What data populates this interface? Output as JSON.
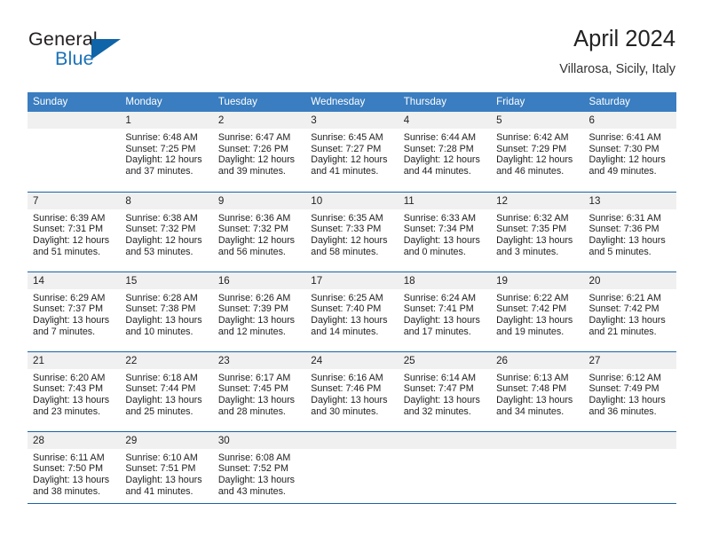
{
  "brand": {
    "name_top": "General",
    "name_bottom": "Blue",
    "flag_icon": "blue-triangle-flag-icon",
    "color_top": "#231f20",
    "color_bottom": "#1b72b8"
  },
  "header": {
    "title": "April 2024",
    "subtitle": "Villarosa, Sicily, Italy"
  },
  "theme": {
    "header_row_bg": "#3a7dc0",
    "header_row_text": "#ffffff",
    "row_divider": "#1a63a8",
    "day_band_bg": "#f0f0f0",
    "body_text": "#222222"
  },
  "weekdays": [
    "Sunday",
    "Monday",
    "Tuesday",
    "Wednesday",
    "Thursday",
    "Friday",
    "Saturday"
  ],
  "weeks": [
    [
      {
        "day": "",
        "lines": []
      },
      {
        "day": "1",
        "lines": [
          "Sunrise: 6:48 AM",
          "Sunset: 7:25 PM",
          "Daylight: 12 hours",
          "and 37 minutes."
        ]
      },
      {
        "day": "2",
        "lines": [
          "Sunrise: 6:47 AM",
          "Sunset: 7:26 PM",
          "Daylight: 12 hours",
          "and 39 minutes."
        ]
      },
      {
        "day": "3",
        "lines": [
          "Sunrise: 6:45 AM",
          "Sunset: 7:27 PM",
          "Daylight: 12 hours",
          "and 41 minutes."
        ]
      },
      {
        "day": "4",
        "lines": [
          "Sunrise: 6:44 AM",
          "Sunset: 7:28 PM",
          "Daylight: 12 hours",
          "and 44 minutes."
        ]
      },
      {
        "day": "5",
        "lines": [
          "Sunrise: 6:42 AM",
          "Sunset: 7:29 PM",
          "Daylight: 12 hours",
          "and 46 minutes."
        ]
      },
      {
        "day": "6",
        "lines": [
          "Sunrise: 6:41 AM",
          "Sunset: 7:30 PM",
          "Daylight: 12 hours",
          "and 49 minutes."
        ]
      }
    ],
    [
      {
        "day": "7",
        "lines": [
          "Sunrise: 6:39 AM",
          "Sunset: 7:31 PM",
          "Daylight: 12 hours",
          "and 51 minutes."
        ]
      },
      {
        "day": "8",
        "lines": [
          "Sunrise: 6:38 AM",
          "Sunset: 7:32 PM",
          "Daylight: 12 hours",
          "and 53 minutes."
        ]
      },
      {
        "day": "9",
        "lines": [
          "Sunrise: 6:36 AM",
          "Sunset: 7:32 PM",
          "Daylight: 12 hours",
          "and 56 minutes."
        ]
      },
      {
        "day": "10",
        "lines": [
          "Sunrise: 6:35 AM",
          "Sunset: 7:33 PM",
          "Daylight: 12 hours",
          "and 58 minutes."
        ]
      },
      {
        "day": "11",
        "lines": [
          "Sunrise: 6:33 AM",
          "Sunset: 7:34 PM",
          "Daylight: 13 hours",
          "and 0 minutes."
        ]
      },
      {
        "day": "12",
        "lines": [
          "Sunrise: 6:32 AM",
          "Sunset: 7:35 PM",
          "Daylight: 13 hours",
          "and 3 minutes."
        ]
      },
      {
        "day": "13",
        "lines": [
          "Sunrise: 6:31 AM",
          "Sunset: 7:36 PM",
          "Daylight: 13 hours",
          "and 5 minutes."
        ]
      }
    ],
    [
      {
        "day": "14",
        "lines": [
          "Sunrise: 6:29 AM",
          "Sunset: 7:37 PM",
          "Daylight: 13 hours",
          "and 7 minutes."
        ]
      },
      {
        "day": "15",
        "lines": [
          "Sunrise: 6:28 AM",
          "Sunset: 7:38 PM",
          "Daylight: 13 hours",
          "and 10 minutes."
        ]
      },
      {
        "day": "16",
        "lines": [
          "Sunrise: 6:26 AM",
          "Sunset: 7:39 PM",
          "Daylight: 13 hours",
          "and 12 minutes."
        ]
      },
      {
        "day": "17",
        "lines": [
          "Sunrise: 6:25 AM",
          "Sunset: 7:40 PM",
          "Daylight: 13 hours",
          "and 14 minutes."
        ]
      },
      {
        "day": "18",
        "lines": [
          "Sunrise: 6:24 AM",
          "Sunset: 7:41 PM",
          "Daylight: 13 hours",
          "and 17 minutes."
        ]
      },
      {
        "day": "19",
        "lines": [
          "Sunrise: 6:22 AM",
          "Sunset: 7:42 PM",
          "Daylight: 13 hours",
          "and 19 minutes."
        ]
      },
      {
        "day": "20",
        "lines": [
          "Sunrise: 6:21 AM",
          "Sunset: 7:42 PM",
          "Daylight: 13 hours",
          "and 21 minutes."
        ]
      }
    ],
    [
      {
        "day": "21",
        "lines": [
          "Sunrise: 6:20 AM",
          "Sunset: 7:43 PM",
          "Daylight: 13 hours",
          "and 23 minutes."
        ]
      },
      {
        "day": "22",
        "lines": [
          "Sunrise: 6:18 AM",
          "Sunset: 7:44 PM",
          "Daylight: 13 hours",
          "and 25 minutes."
        ]
      },
      {
        "day": "23",
        "lines": [
          "Sunrise: 6:17 AM",
          "Sunset: 7:45 PM",
          "Daylight: 13 hours",
          "and 28 minutes."
        ]
      },
      {
        "day": "24",
        "lines": [
          "Sunrise: 6:16 AM",
          "Sunset: 7:46 PM",
          "Daylight: 13 hours",
          "and 30 minutes."
        ]
      },
      {
        "day": "25",
        "lines": [
          "Sunrise: 6:14 AM",
          "Sunset: 7:47 PM",
          "Daylight: 13 hours",
          "and 32 minutes."
        ]
      },
      {
        "day": "26",
        "lines": [
          "Sunrise: 6:13 AM",
          "Sunset: 7:48 PM",
          "Daylight: 13 hours",
          "and 34 minutes."
        ]
      },
      {
        "day": "27",
        "lines": [
          "Sunrise: 6:12 AM",
          "Sunset: 7:49 PM",
          "Daylight: 13 hours",
          "and 36 minutes."
        ]
      }
    ],
    [
      {
        "day": "28",
        "lines": [
          "Sunrise: 6:11 AM",
          "Sunset: 7:50 PM",
          "Daylight: 13 hours",
          "and 38 minutes."
        ]
      },
      {
        "day": "29",
        "lines": [
          "Sunrise: 6:10 AM",
          "Sunset: 7:51 PM",
          "Daylight: 13 hours",
          "and 41 minutes."
        ]
      },
      {
        "day": "30",
        "lines": [
          "Sunrise: 6:08 AM",
          "Sunset: 7:52 PM",
          "Daylight: 13 hours",
          "and 43 minutes."
        ]
      },
      {
        "day": "",
        "lines": []
      },
      {
        "day": "",
        "lines": []
      },
      {
        "day": "",
        "lines": []
      },
      {
        "day": "",
        "lines": []
      }
    ]
  ]
}
